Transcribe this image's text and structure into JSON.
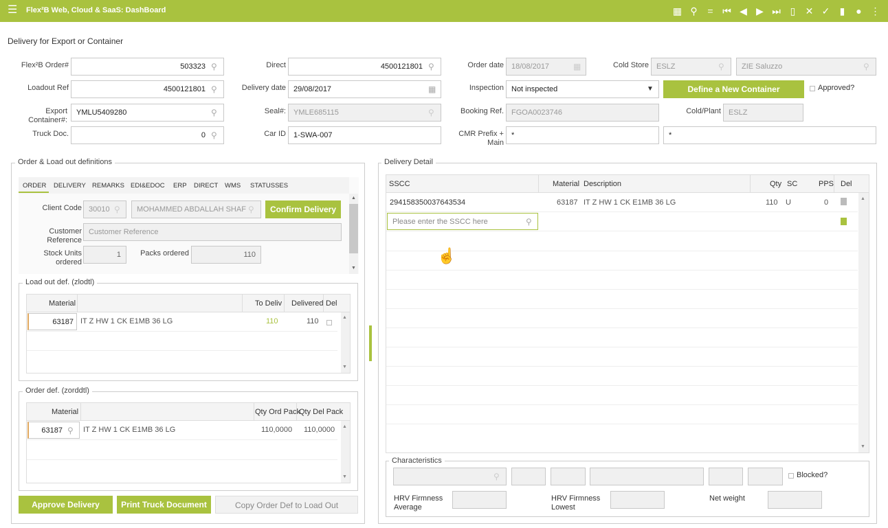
{
  "app": {
    "title": "Flex²B Web, Cloud & SaaS: DashBoard",
    "toolbar_icons": [
      "calendar-icon",
      "search-icon",
      "equals-icon",
      "first-icon",
      "prev-icon",
      "next-icon",
      "last-icon",
      "new-doc-icon",
      "cancel-icon",
      "confirm-icon",
      "delete-icon",
      "user-icon",
      "more-icon"
    ]
  },
  "page": {
    "title": "Delivery for Export or Container"
  },
  "header": {
    "order_label": "Flex²B Order#",
    "order_value": "503323",
    "loadout_label": "Loadout Ref",
    "loadout_value": "4500121801",
    "container_label": "Export Container#:",
    "container_value": "YMLU5409280",
    "truck_label": "Truck Doc.",
    "truck_value": "0",
    "direct_label": "Direct",
    "direct_value": "4500121801",
    "delivery_date_label": "Delivery date",
    "delivery_date_value": "29/08/2017",
    "seal_label": "Seal#:",
    "seal_value": "YMLE685115",
    "car_label": "Car ID",
    "car_value": "1-SWA-007",
    "order_date_label": "Order date",
    "order_date_value": "18/08/2017",
    "inspection_label": "Inspection",
    "inspection_value": "Not inspected",
    "booking_label": "Booking Ref.",
    "booking_value": "FGOA0023746",
    "cmr_label": "CMR Prefix + Main",
    "cmr_value1": "*",
    "cmr_value2": "*",
    "cold_store_label": "Cold Store",
    "cold_store_code": "ESLZ",
    "cold_store_name": "ZIE Saluzzo",
    "cold_plant_label": "Cold/Plant",
    "cold_plant_value": "ESLZ",
    "define_container": "Define a New Container",
    "approved_label": "Approved?"
  },
  "left": {
    "legend": "Order & Load out definitions",
    "tabs": [
      "ORDER",
      "DELIVERY",
      "REMARKS",
      "EDI&EDOC",
      "ERP",
      "DIRECT",
      "WMS",
      "STATUSSES"
    ],
    "client_code_label": "Client Code",
    "client_code_value": "30010",
    "client_name": "MOHAMMED ABDALLAH SHAF",
    "confirm_delivery": "Confirm Delivery",
    "customer_ref_label": "Customer Reference",
    "customer_ref_placeholder": "Customer Reference",
    "stock_units_label": "Stock Units ordered",
    "stock_units_value": "1",
    "packs_ordered_label": "Packs ordered",
    "packs_ordered_value": "110",
    "loadout": {
      "legend": "Load out def. (zlodtl)",
      "headers": [
        "Material",
        "To Deliv",
        "Delivered",
        "Del"
      ],
      "rows": [
        {
          "material": "63187",
          "description": "IT Z HW 1 CK E1MB 36 LG",
          "to_deliv": "110",
          "delivered": "110"
        }
      ]
    },
    "orderdef": {
      "legend": "Order def. (zorddtl)",
      "headers": [
        "Material",
        "Qty Ord Pack",
        "Qty Del Pack"
      ],
      "rows": [
        {
          "material": "63187",
          "description": "IT Z HW 1 CK E1MB 36 LG",
          "qty_ord": "110,0000",
          "qty_del": "110,0000"
        }
      ]
    },
    "approve_delivery": "Approve Delivery",
    "print_truck": "Print Truck Document",
    "copy_order": "Copy Order Def to Load Out"
  },
  "right": {
    "legend": "Delivery Detail",
    "headers": [
      "SSCC",
      "Material",
      "Description",
      "Qty",
      "SC",
      "PPS",
      "Del"
    ],
    "rows": [
      {
        "sscc": "294158350037643534",
        "material": "63187",
        "description": "IT Z HW 1 CK E1MB 36 LG",
        "qty": "110",
        "sc": "U",
        "pps": "0"
      }
    ],
    "sscc_placeholder": "Please enter the SSCC here",
    "characteristics": {
      "legend": "Characteristics",
      "blocked_label": "Blocked?",
      "hrv_avg_label": "HRV Firmness Average",
      "hrv_low_label": "HRV Firmness Lowest",
      "net_weight_label": "Net weight"
    }
  },
  "colors": {
    "accent": "#a9c23f"
  }
}
